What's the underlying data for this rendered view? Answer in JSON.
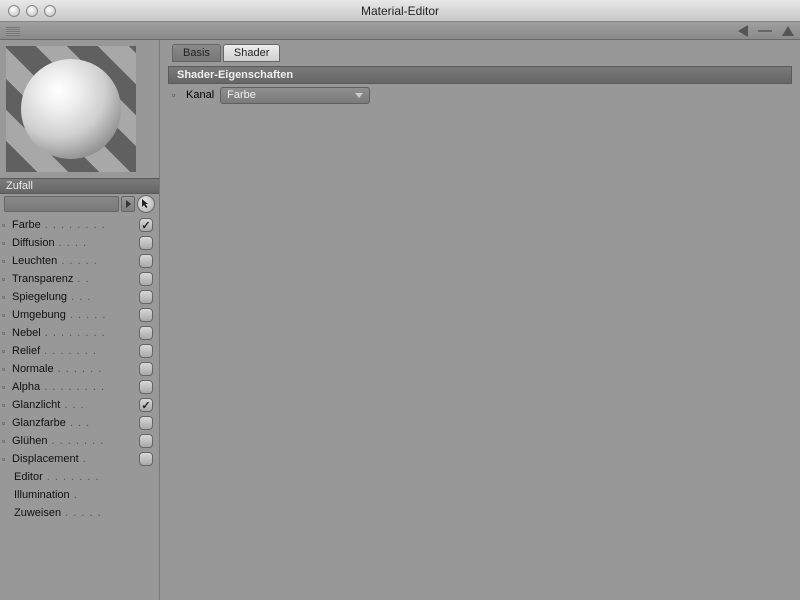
{
  "window": {
    "title": "Material-Editor"
  },
  "material": {
    "name": "Zufall"
  },
  "tabs": {
    "basis": "Basis",
    "shader": "Shader",
    "active": "shader"
  },
  "section": {
    "title": "Shader-Eigenschaften"
  },
  "kanal": {
    "label": "Kanal",
    "value": "Farbe"
  },
  "channels": [
    {
      "id": "farbe",
      "label": "Farbe",
      "checked": true,
      "expandable": true
    },
    {
      "id": "diffusion",
      "label": "Diffusion",
      "checked": false,
      "expandable": true
    },
    {
      "id": "leuchten",
      "label": "Leuchten",
      "checked": false,
      "expandable": true
    },
    {
      "id": "transparenz",
      "label": "Transparenz",
      "checked": false,
      "expandable": true
    },
    {
      "id": "spiegelung",
      "label": "Spiegelung",
      "checked": false,
      "expandable": true
    },
    {
      "id": "umgebung",
      "label": "Umgebung",
      "checked": false,
      "expandable": true
    },
    {
      "id": "nebel",
      "label": "Nebel",
      "checked": false,
      "expandable": true
    },
    {
      "id": "relief",
      "label": "Relief",
      "checked": false,
      "expandable": true
    },
    {
      "id": "normale",
      "label": "Normale",
      "checked": false,
      "expandable": true
    },
    {
      "id": "alpha",
      "label": "Alpha",
      "checked": false,
      "expandable": true
    },
    {
      "id": "glanzlicht",
      "label": "Glanzlicht",
      "checked": true,
      "expandable": true
    },
    {
      "id": "glanzfarbe",
      "label": "Glanzfarbe",
      "checked": false,
      "expandable": true
    },
    {
      "id": "gluehen",
      "label": "Glühen",
      "checked": false,
      "expandable": true
    },
    {
      "id": "displacement",
      "label": "Displacement",
      "checked": false,
      "expandable": true
    }
  ],
  "sub_items": [
    {
      "id": "editor",
      "label": "Editor"
    },
    {
      "id": "illumination",
      "label": "Illumination"
    },
    {
      "id": "zuweisen",
      "label": "Zuweisen"
    }
  ]
}
